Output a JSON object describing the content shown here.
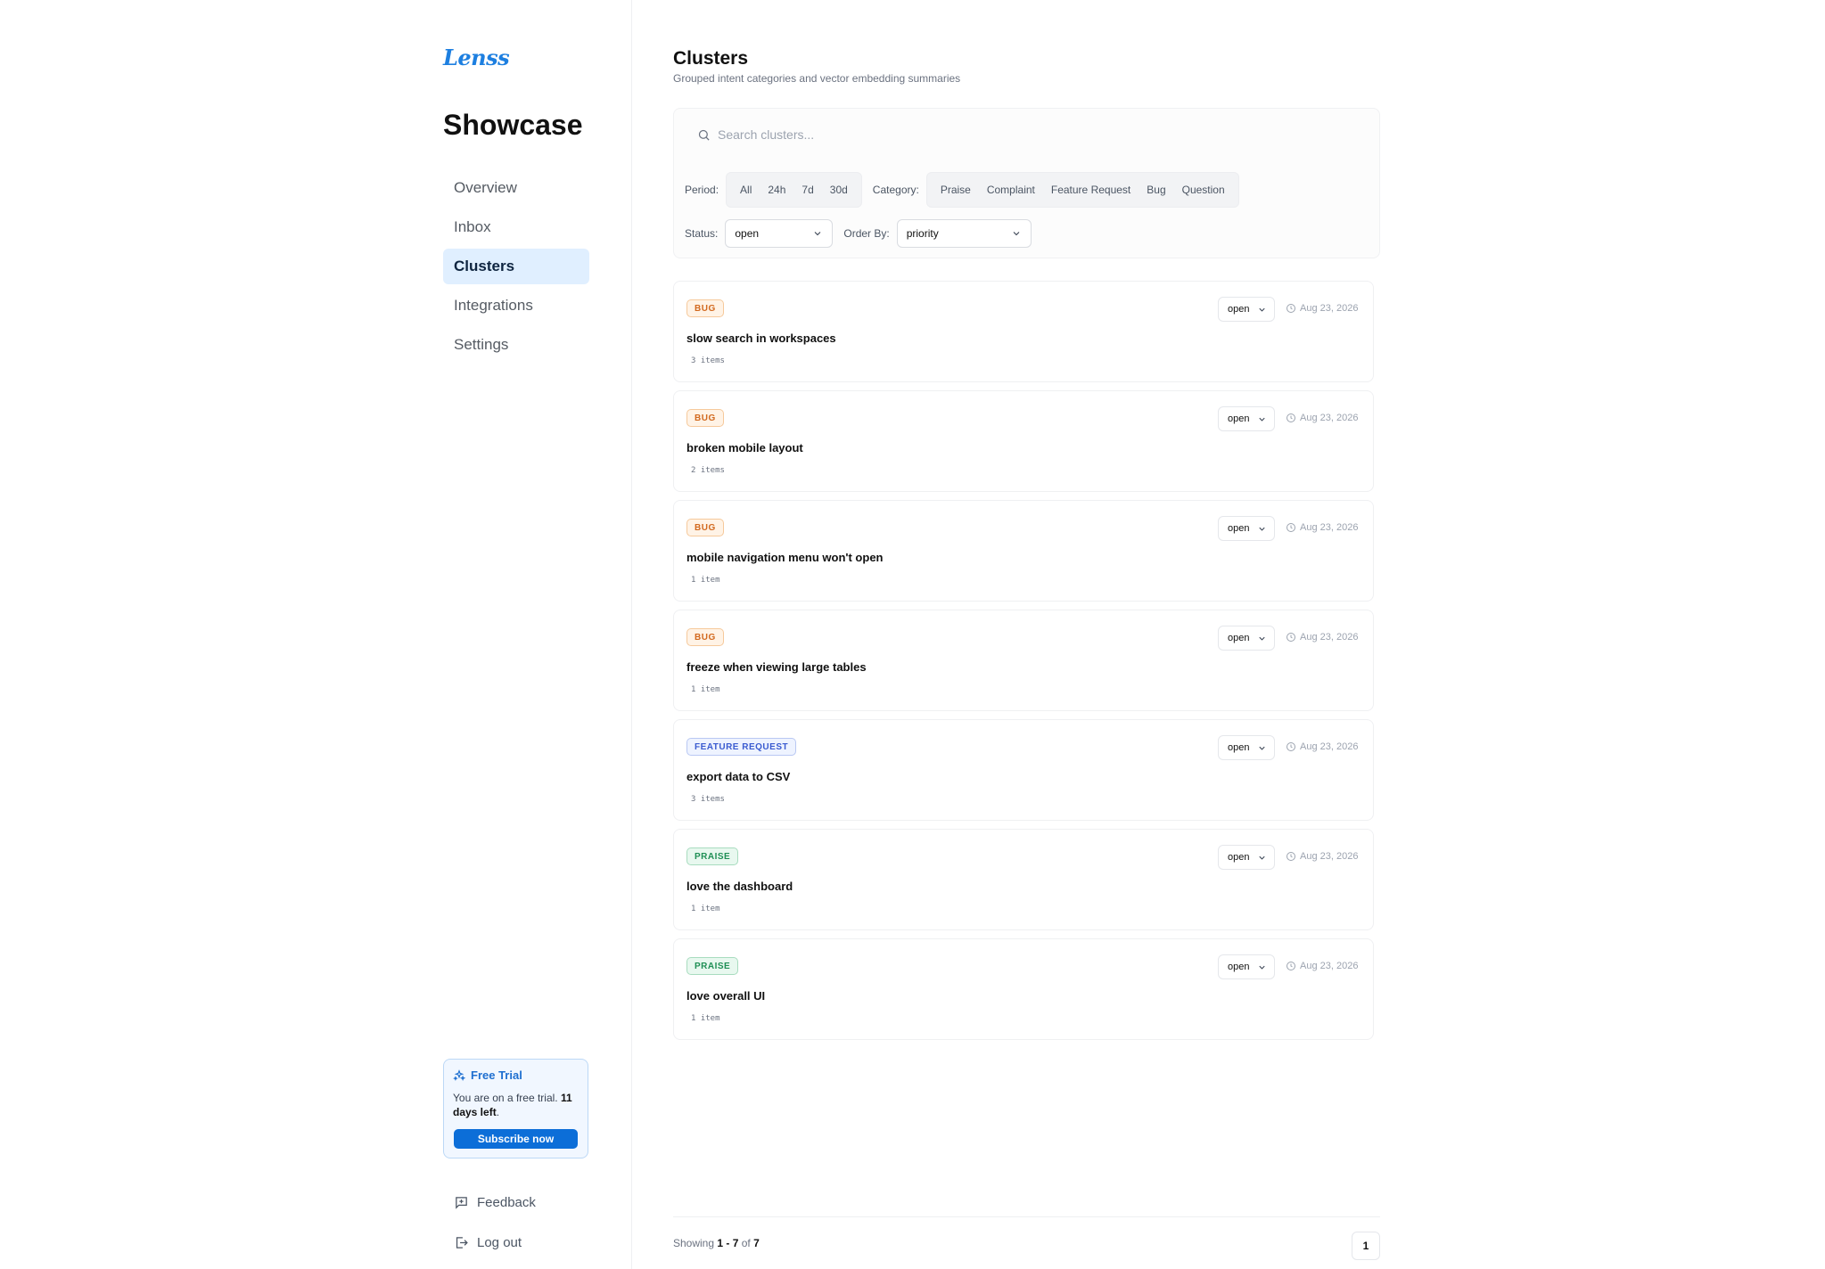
{
  "brand": {
    "logo": "Lenss",
    "accent": "#1d7fe0"
  },
  "sidebar": {
    "workspace_title": "Showcase",
    "items": [
      {
        "label": "Overview"
      },
      {
        "label": "Inbox"
      },
      {
        "label": "Clusters",
        "active": true
      },
      {
        "label": "Integrations"
      },
      {
        "label": "Settings"
      }
    ],
    "trial": {
      "title": "Free Trial",
      "text_prefix": "You are on a free trial. ",
      "text_bold": "11 days left",
      "text_suffix": ".",
      "button": "Subscribe now"
    },
    "feedback": "Feedback",
    "logout": "Log out"
  },
  "header": {
    "title": "Clusters",
    "subtitle": "Grouped intent categories and vector embedding summaries"
  },
  "filters": {
    "search_placeholder": "Search clusters...",
    "period_label": "Period:",
    "periods": [
      "All",
      "24h",
      "7d",
      "30d"
    ],
    "category_label": "Category:",
    "categories": [
      "Praise",
      "Complaint",
      "Feature Request",
      "Bug",
      "Question"
    ],
    "status_label": "Status:",
    "status_value": "open",
    "order_label": "Order By:",
    "order_value": "priority"
  },
  "clusters": [
    {
      "badge": "BUG",
      "kind": "bug",
      "title": "slow search in workspaces",
      "count": "3 items",
      "status": "open",
      "date": "Aug 23, 2026"
    },
    {
      "badge": "BUG",
      "kind": "bug",
      "title": "broken mobile layout",
      "count": "2 items",
      "status": "open",
      "date": "Aug 23, 2026"
    },
    {
      "badge": "BUG",
      "kind": "bug",
      "title": "mobile navigation menu won't open",
      "count": "1 item",
      "status": "open",
      "date": "Aug 23, 2026"
    },
    {
      "badge": "BUG",
      "kind": "bug",
      "title": "freeze when viewing large tables",
      "count": "1 item",
      "status": "open",
      "date": "Aug 23, 2026"
    },
    {
      "badge": "FEATURE REQUEST",
      "kind": "feature",
      "title": "export data to CSV",
      "count": "3 items",
      "status": "open",
      "date": "Aug 23, 2026"
    },
    {
      "badge": "PRAISE",
      "kind": "praise",
      "title": "love the dashboard",
      "count": "1 item",
      "status": "open",
      "date": "Aug 23, 2026"
    },
    {
      "badge": "PRAISE",
      "kind": "praise",
      "title": "love overall UI",
      "count": "1 item",
      "status": "open",
      "date": "Aug 23, 2026"
    }
  ],
  "pagination": {
    "showing_prefix": "Showing ",
    "range": "1 - 7",
    "of": " of ",
    "total": "7",
    "current_page": "1"
  }
}
